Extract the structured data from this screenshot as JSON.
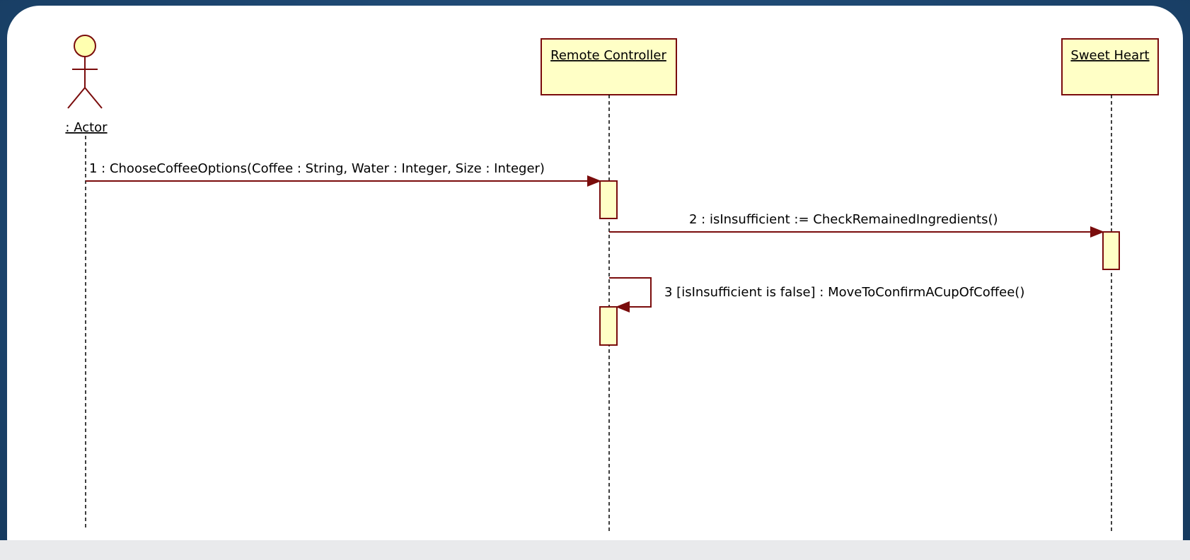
{
  "diagram": {
    "type": "uml-sequence-diagram",
    "lifelines": [
      {
        "name": ": Actor",
        "kind": "actor"
      },
      {
        "name": "Remote Controller",
        "kind": "object"
      },
      {
        "name": "Sweet Heart",
        "kind": "object"
      }
    ],
    "messages": [
      {
        "label": "1 : ChooseCoffeeOptions(Coffee : String, Water : Integer, Size : Integer)",
        "from": ": Actor",
        "to": "Remote Controller"
      },
      {
        "label": "2 : isInsufficient := CheckRemainedIngredients()",
        "from": "Remote Controller",
        "to": "Sweet Heart"
      },
      {
        "label": "3 [isInsufficient is false] : MoveToConfirmACupOfCoffee()",
        "from": "Remote Controller",
        "to": "Remote Controller"
      }
    ],
    "colors": {
      "line": "#7a0c0c",
      "box_fill": "#ffffc6",
      "actor_head": "#ffffb0"
    }
  }
}
